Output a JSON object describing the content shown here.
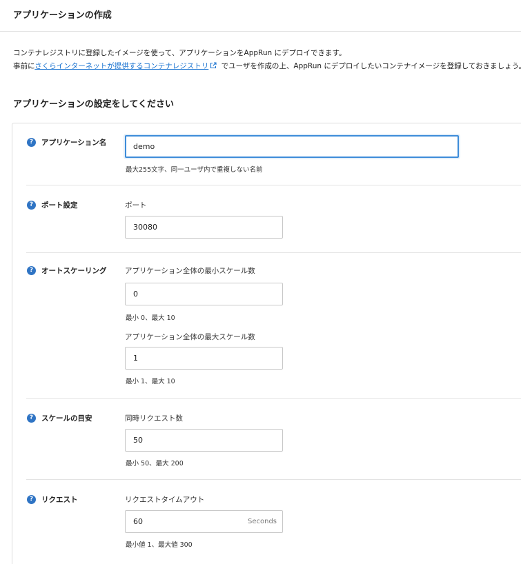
{
  "page": {
    "title": "アプリケーションの作成"
  },
  "intro": {
    "line1": "コンテナレジストリに登録したイメージを使って、アプリケーションをAppRun にデプロイできます。",
    "line2_prefix": "事前に",
    "link_text": "さくらインターネットが提供するコンテナレジストリ",
    "line2_suffix": " でユーザを作成の上、AppRun にデプロイしたいコンテナイメージを登録しておきましょう。"
  },
  "section": {
    "title": "アプリケーションの設定をしてください"
  },
  "help_glyph": "?",
  "app_name": {
    "label": "アプリケーション名",
    "value": "demo",
    "hint": "最大255文字、同一ユーザ内で重複しない名前"
  },
  "port": {
    "label": "ポート設定",
    "field_label": "ポート",
    "value": "30080"
  },
  "autoscaling": {
    "label": "オートスケーリング",
    "min_label": "アプリケーション全体の最小スケール数",
    "min_value": "0",
    "min_hint": "最小 0、最大 10",
    "max_label": "アプリケーション全体の最大スケール数",
    "max_value": "1",
    "max_hint": "最小 1、最大 10"
  },
  "scale_target": {
    "label": "スケールの目安",
    "field_label": "同時リクエスト数",
    "value": "50",
    "hint": "最小 50、最大 200"
  },
  "request": {
    "label": "リクエスト",
    "field_label": "リクエストタイムアウト",
    "value": "60",
    "suffix": "Seconds",
    "hint": "最小値 1、最大値 300"
  },
  "colors": {
    "accent": "#2f74c4",
    "link": "#1a73d0",
    "focus_border": "#3d8cd9"
  },
  "icons": {
    "help": "help-circle-icon",
    "external": "external-link-icon"
  }
}
